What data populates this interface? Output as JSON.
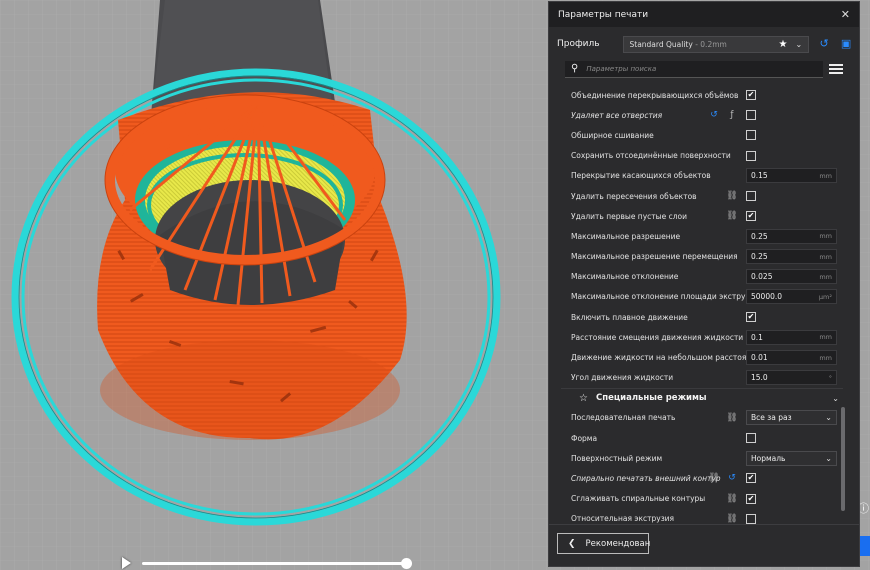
{
  "panel": {
    "title": "Параметры печати",
    "close": "✕",
    "profile_label": "Профиль",
    "profile_name": "Standard Quality",
    "profile_suffix": " - 0.2mm",
    "search_placeholder": "Параметры поиска",
    "accent_color": "#2a8cff",
    "footer_button": "Рекомендован"
  },
  "settings": [
    {
      "label": "Объединение перекрывающихся объёмов",
      "kind": "check",
      "checked": true
    },
    {
      "label": "Удаляет все отверстия",
      "kind": "check",
      "checked": false,
      "italic": true,
      "icons": [
        "reset-icon",
        "function-icon"
      ]
    },
    {
      "label": "Обширное сшивание",
      "kind": "check",
      "checked": false
    },
    {
      "label": "Сохранить отсоединённые поверхности",
      "kind": "check",
      "checked": false
    },
    {
      "label": "Перекрытие касающихся объектов",
      "kind": "num",
      "value": "0.15",
      "unit": "mm"
    },
    {
      "label": "Удалить пересечения объектов",
      "kind": "check",
      "checked": false,
      "icons": [
        "link-icon"
      ]
    },
    {
      "label": "Удалить первые пустые слои",
      "kind": "check",
      "checked": true,
      "icons": [
        "link-icon"
      ]
    },
    {
      "label": "Максимальное разрешение",
      "kind": "num",
      "value": "0.25",
      "unit": "mm"
    },
    {
      "label": "Максимальное разрешение перемещения",
      "kind": "num",
      "value": "0.25",
      "unit": "mm"
    },
    {
      "label": "Максимальное отклонение",
      "kind": "num",
      "value": "0.025",
      "unit": "mm"
    },
    {
      "label": "Максимальное отклонение площади экструзии",
      "kind": "num",
      "value": "50000.0",
      "unit": "μm²"
    },
    {
      "label": "Включить плавное движение",
      "kind": "check",
      "checked": true
    },
    {
      "label": "Расстояние смещения движения жидкости",
      "kind": "num",
      "value": "0.1",
      "unit": "mm"
    },
    {
      "label": "Движение жидкости на небольшом расстоянии",
      "kind": "num",
      "value": "0.01",
      "unit": "mm"
    },
    {
      "label": "Угол движения жидкости",
      "kind": "num",
      "value": "15.0",
      "unit": "°"
    }
  ],
  "section": {
    "title": "Специальные режимы"
  },
  "special": [
    {
      "label": "Последовательная печать",
      "kind": "sel",
      "value": "Все за раз",
      "icons": [
        "link-icon"
      ]
    },
    {
      "label": "Форма",
      "kind": "check",
      "checked": false
    },
    {
      "label": "Поверхностный режим",
      "kind": "sel",
      "value": "Нормаль"
    },
    {
      "label": "Спирально печатать внешний контур",
      "kind": "check",
      "checked": true,
      "italic": true,
      "icons": [
        "link-icon",
        "reset-icon"
      ]
    },
    {
      "label": "Сглаживать спиральные контуры",
      "kind": "check",
      "checked": true,
      "icons": [
        "link-icon"
      ]
    },
    {
      "label": "Относительная экструзия",
      "kind": "check",
      "checked": false,
      "icons": [
        "link-icon"
      ]
    }
  ],
  "viewport": {
    "bed_color": "#a3a3a3",
    "shell_color": "#f05a1e",
    "skirt_color": "#2ad8d8",
    "infill_color": "#e8e84a",
    "support_color": "#1fb59a"
  },
  "layer_slider": {
    "position": 0.97
  }
}
